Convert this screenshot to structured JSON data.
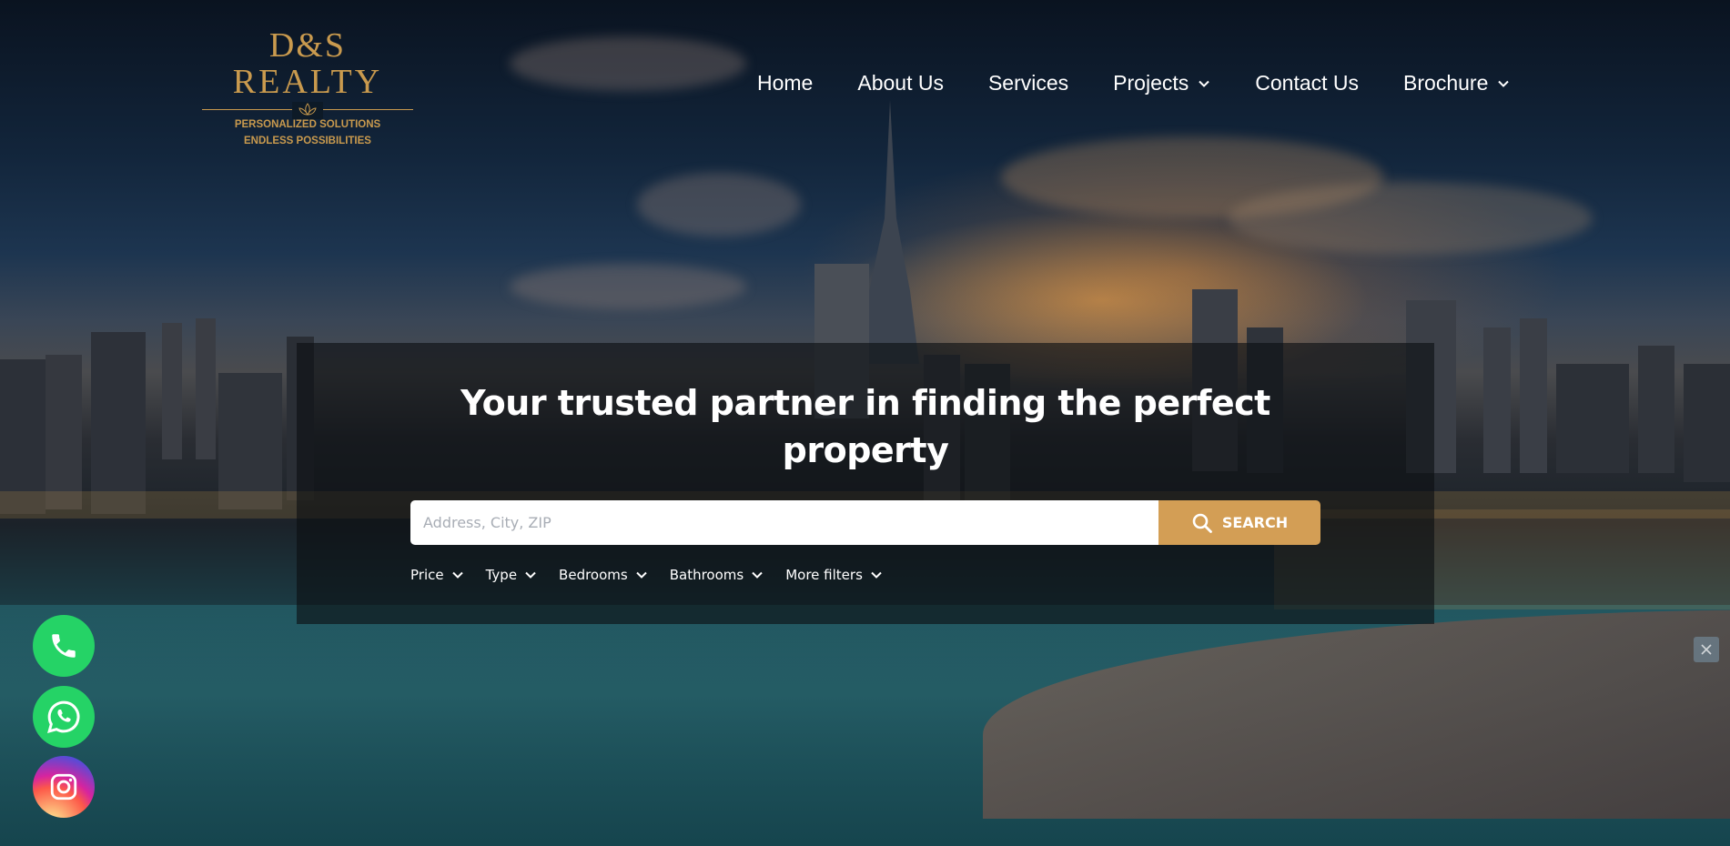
{
  "logo": {
    "line1": "D&S",
    "line2": "REALTY",
    "tagline1": "PERSONALIZED SOLUTIONS",
    "tagline2": "ENDLESS POSSIBILITIES",
    "color": "#c99a4e"
  },
  "nav": {
    "items": [
      {
        "label": "Home",
        "dropdown": false
      },
      {
        "label": "About Us",
        "dropdown": false
      },
      {
        "label": "Services",
        "dropdown": false
      },
      {
        "label": "Projects",
        "dropdown": true
      },
      {
        "label": "Contact Us",
        "dropdown": false
      },
      {
        "label": "Brochure",
        "dropdown": true
      }
    ]
  },
  "hero": {
    "headline": "Your trusted partner in finding the perfect property"
  },
  "search": {
    "placeholder": "Address, City, ZIP",
    "button_label": "SEARCH",
    "button_color": "#d39e55"
  },
  "filters": [
    {
      "label": "Price"
    },
    {
      "label": "Type"
    },
    {
      "label": "Bedrooms"
    },
    {
      "label": "Bathrooms"
    },
    {
      "label": "More filters"
    }
  ],
  "floating_buttons": [
    {
      "icon": "phone-icon",
      "color": "#25d366"
    },
    {
      "icon": "whatsapp-icon",
      "color": "#25d366"
    },
    {
      "icon": "instagram-icon"
    }
  ]
}
